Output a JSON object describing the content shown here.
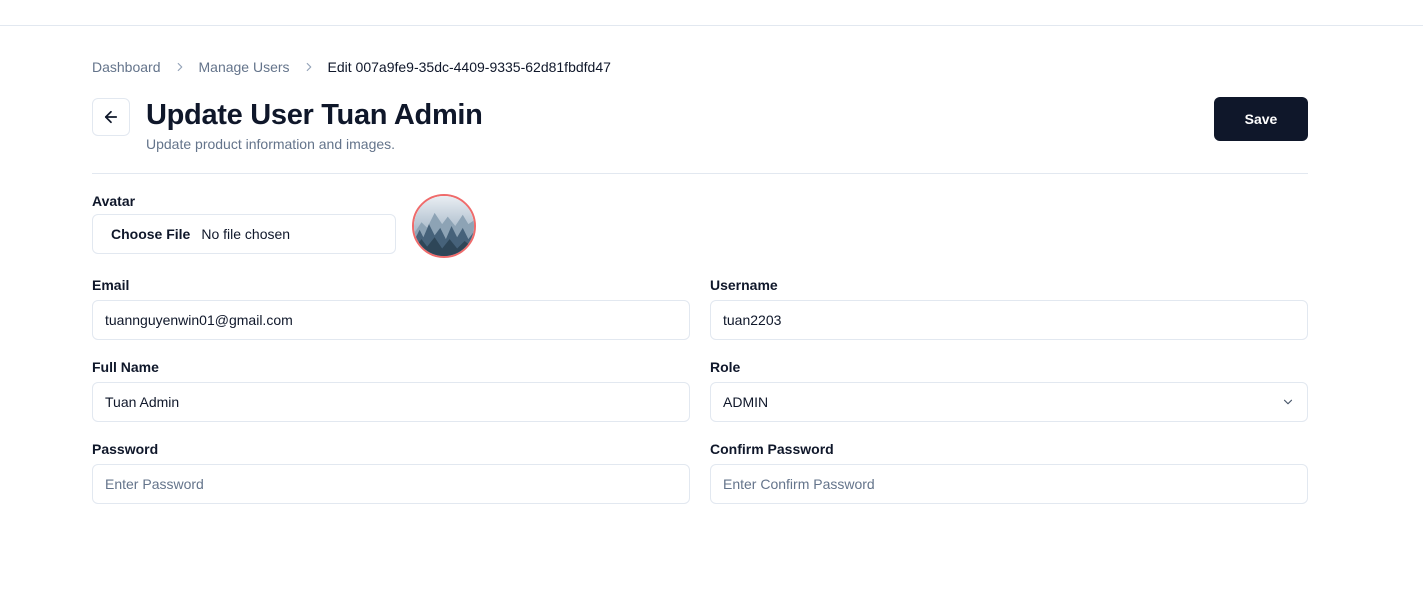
{
  "breadcrumb": {
    "items": [
      "Dashboard",
      "Manage Users"
    ],
    "current": "Edit 007a9fe9-35dc-4409-9335-62d81fbdfd47"
  },
  "header": {
    "title": "Update User Tuan Admin",
    "subtitle": "Update product information and images.",
    "save_label": "Save"
  },
  "form": {
    "avatar": {
      "label": "Avatar",
      "button": "Choose File",
      "status": "No file chosen"
    },
    "email": {
      "label": "Email",
      "value": "tuannguyenwin01@gmail.com"
    },
    "username": {
      "label": "Username",
      "value": "tuan2203"
    },
    "full_name": {
      "label": "Full Name",
      "value": "Tuan Admin"
    },
    "role": {
      "label": "Role",
      "value": "ADMIN"
    },
    "password": {
      "label": "Password",
      "placeholder": "Enter Password"
    },
    "confirm_password": {
      "label": "Confirm Password",
      "placeholder": "Enter Confirm Password"
    }
  },
  "icons": {
    "back": "arrow-left-icon",
    "separator": "chevron-right-icon",
    "select": "chevron-down-icon"
  },
  "colors": {
    "primary": "#0f172a",
    "muted": "#64748b",
    "border": "#e2e8f0",
    "avatar_ring": "#ef6b6b"
  }
}
